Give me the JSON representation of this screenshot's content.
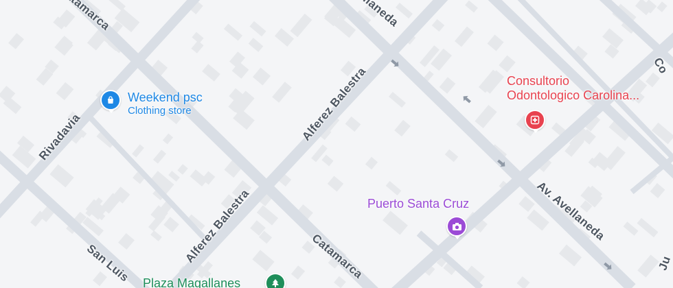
{
  "colors": {
    "background": "#f4f5f7",
    "road": "#d9dee5",
    "road_edge": "#cfd5dd",
    "building": "#e6e8eb",
    "street_label": "#4d5661",
    "shopping": "#1e88e5",
    "medical": "#e8424f",
    "tourism": "#9b4bd6",
    "park": "#1e8e5a"
  },
  "streets": {
    "catamarca_top": "Catamarca",
    "catamarca_bottom": "Catamarca",
    "rivadavia": "Rivadavia",
    "alferez_balestra_top": "Alferez Balestra",
    "alferez_balestra_bottom": "Alferez Balestra",
    "avellaneda_top": "Avellaneda",
    "av_avellaneda": "Av. Avellaneda",
    "san_luis": "San Luis",
    "partial_right_top": "Co",
    "partial_right_bottom": "Ju"
  },
  "pois": {
    "weekend": {
      "name": "Weekend psc",
      "category": "Clothing store",
      "icon": "shopping-bag-icon"
    },
    "consultorio": {
      "name_line1": "Consultorio",
      "name_line2": "Odontologico Carolina...",
      "icon": "medical-cross-icon"
    },
    "puerto": {
      "name": "Puerto Santa Cruz",
      "icon": "camera-icon"
    },
    "plaza": {
      "name": "Plaza Magallanes",
      "icon": "tree-icon"
    }
  }
}
